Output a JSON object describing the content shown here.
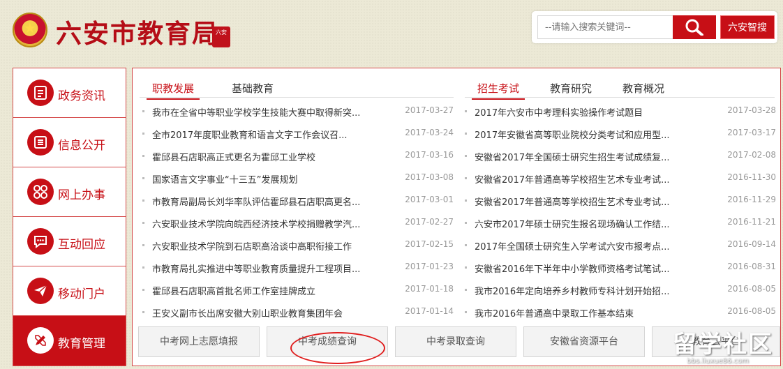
{
  "header": {
    "site_title": "六安市教育局",
    "seal_text": "六安",
    "search_placeholder": "--请输入搜索关键词--",
    "search_button": "六安智搜"
  },
  "sidebar": {
    "items": [
      {
        "label": "政务资讯",
        "icon": "document-icon"
      },
      {
        "label": "信息公开",
        "icon": "list-icon"
      },
      {
        "label": "网上办事",
        "icon": "grid-icon"
      },
      {
        "label": "互动回应",
        "icon": "chat-icon"
      },
      {
        "label": "移动门户",
        "icon": "paper-plane-icon"
      },
      {
        "label": "教育管理",
        "icon": "pencil-ruler-icon",
        "active": true
      }
    ]
  },
  "left_tabs": [
    {
      "label": "职教发展",
      "active": true
    },
    {
      "label": "基础教育",
      "active": false
    }
  ],
  "right_tabs": [
    {
      "label": "招生考试",
      "active": true
    },
    {
      "label": "教育研究",
      "active": false
    },
    {
      "label": "教育概况",
      "active": false
    }
  ],
  "left_news": [
    {
      "title": "我市在全省中等职业学校学生技能大赛中取得新突...",
      "date": "2017-03-27"
    },
    {
      "title": "全市2017年度职业教育和语言文字工作会议召...",
      "date": "2017-03-24"
    },
    {
      "title": "霍邱县石店职高正式更名为霍邱工业学校",
      "date": "2017-03-16"
    },
    {
      "title": "国家语言文字事业“十三五”发展规划",
      "date": "2017-03-08"
    },
    {
      "title": "市教育局副局长刘华率队评估霍邱县石店职高更名...",
      "date": "2017-03-01"
    },
    {
      "title": "六安职业技术学院向皖西经济技术学校捐赠教学汽...",
      "date": "2017-02-27"
    },
    {
      "title": "六安职业技术学院到石店职高洽谈中高职衔接工作",
      "date": "2017-02-15"
    },
    {
      "title": "市教育局扎实推进中等职业教育质量提升工程项目...",
      "date": "2017-01-23"
    },
    {
      "title": "霍邱县石店职高首批名师工作室挂牌成立",
      "date": "2017-01-18"
    },
    {
      "title": "王安义副市长出席安徽大别山职业教育集团年会",
      "date": "2017-01-14"
    }
  ],
  "right_news": [
    {
      "title": "2017年六安市中考理科实验操作考试题目",
      "date": "2017-03-28"
    },
    {
      "title": "2017年安徽省高等职业院校分类考试和应用型...",
      "date": "2017-03-17"
    },
    {
      "title": "安徽省2017年全国硕士研究生招生考试成绩复...",
      "date": "2017-02-08"
    },
    {
      "title": "安徽省2017年普通高等学校招生艺术专业考试...",
      "date": "2016-11-30"
    },
    {
      "title": "安徽省2017年普通高等学校招生艺术专业考试...",
      "date": "2016-11-29"
    },
    {
      "title": "六安市2017年硕士研究生报名现场确认工作结...",
      "date": "2016-11-21"
    },
    {
      "title": "2017年全国硕士研究生入学考试六安市报考点...",
      "date": "2016-09-14"
    },
    {
      "title": "安徽省2016年下半年中小学教师资格考试笔试...",
      "date": "2016-08-31"
    },
    {
      "title": "我市2016年定向培养乡村教师专科计划开始招...",
      "date": "2016-08-05"
    },
    {
      "title": "我市2016年普通高中录取工作基本结束",
      "date": "2016-08-05"
    }
  ],
  "quick_links": [
    {
      "label": "中考网上志愿填报"
    },
    {
      "label": "中考成绩查询"
    },
    {
      "label": "中考录取查询"
    },
    {
      "label": "安徽省资源平台"
    },
    {
      "label": "教育云平台"
    }
  ],
  "watermark": {
    "main": "留学社区",
    "sub": "bbs.liuxue86.com"
  },
  "colors": {
    "brand_red": "#c70f16",
    "border_red": "#d54a4a",
    "date_gray": "#999999"
  }
}
